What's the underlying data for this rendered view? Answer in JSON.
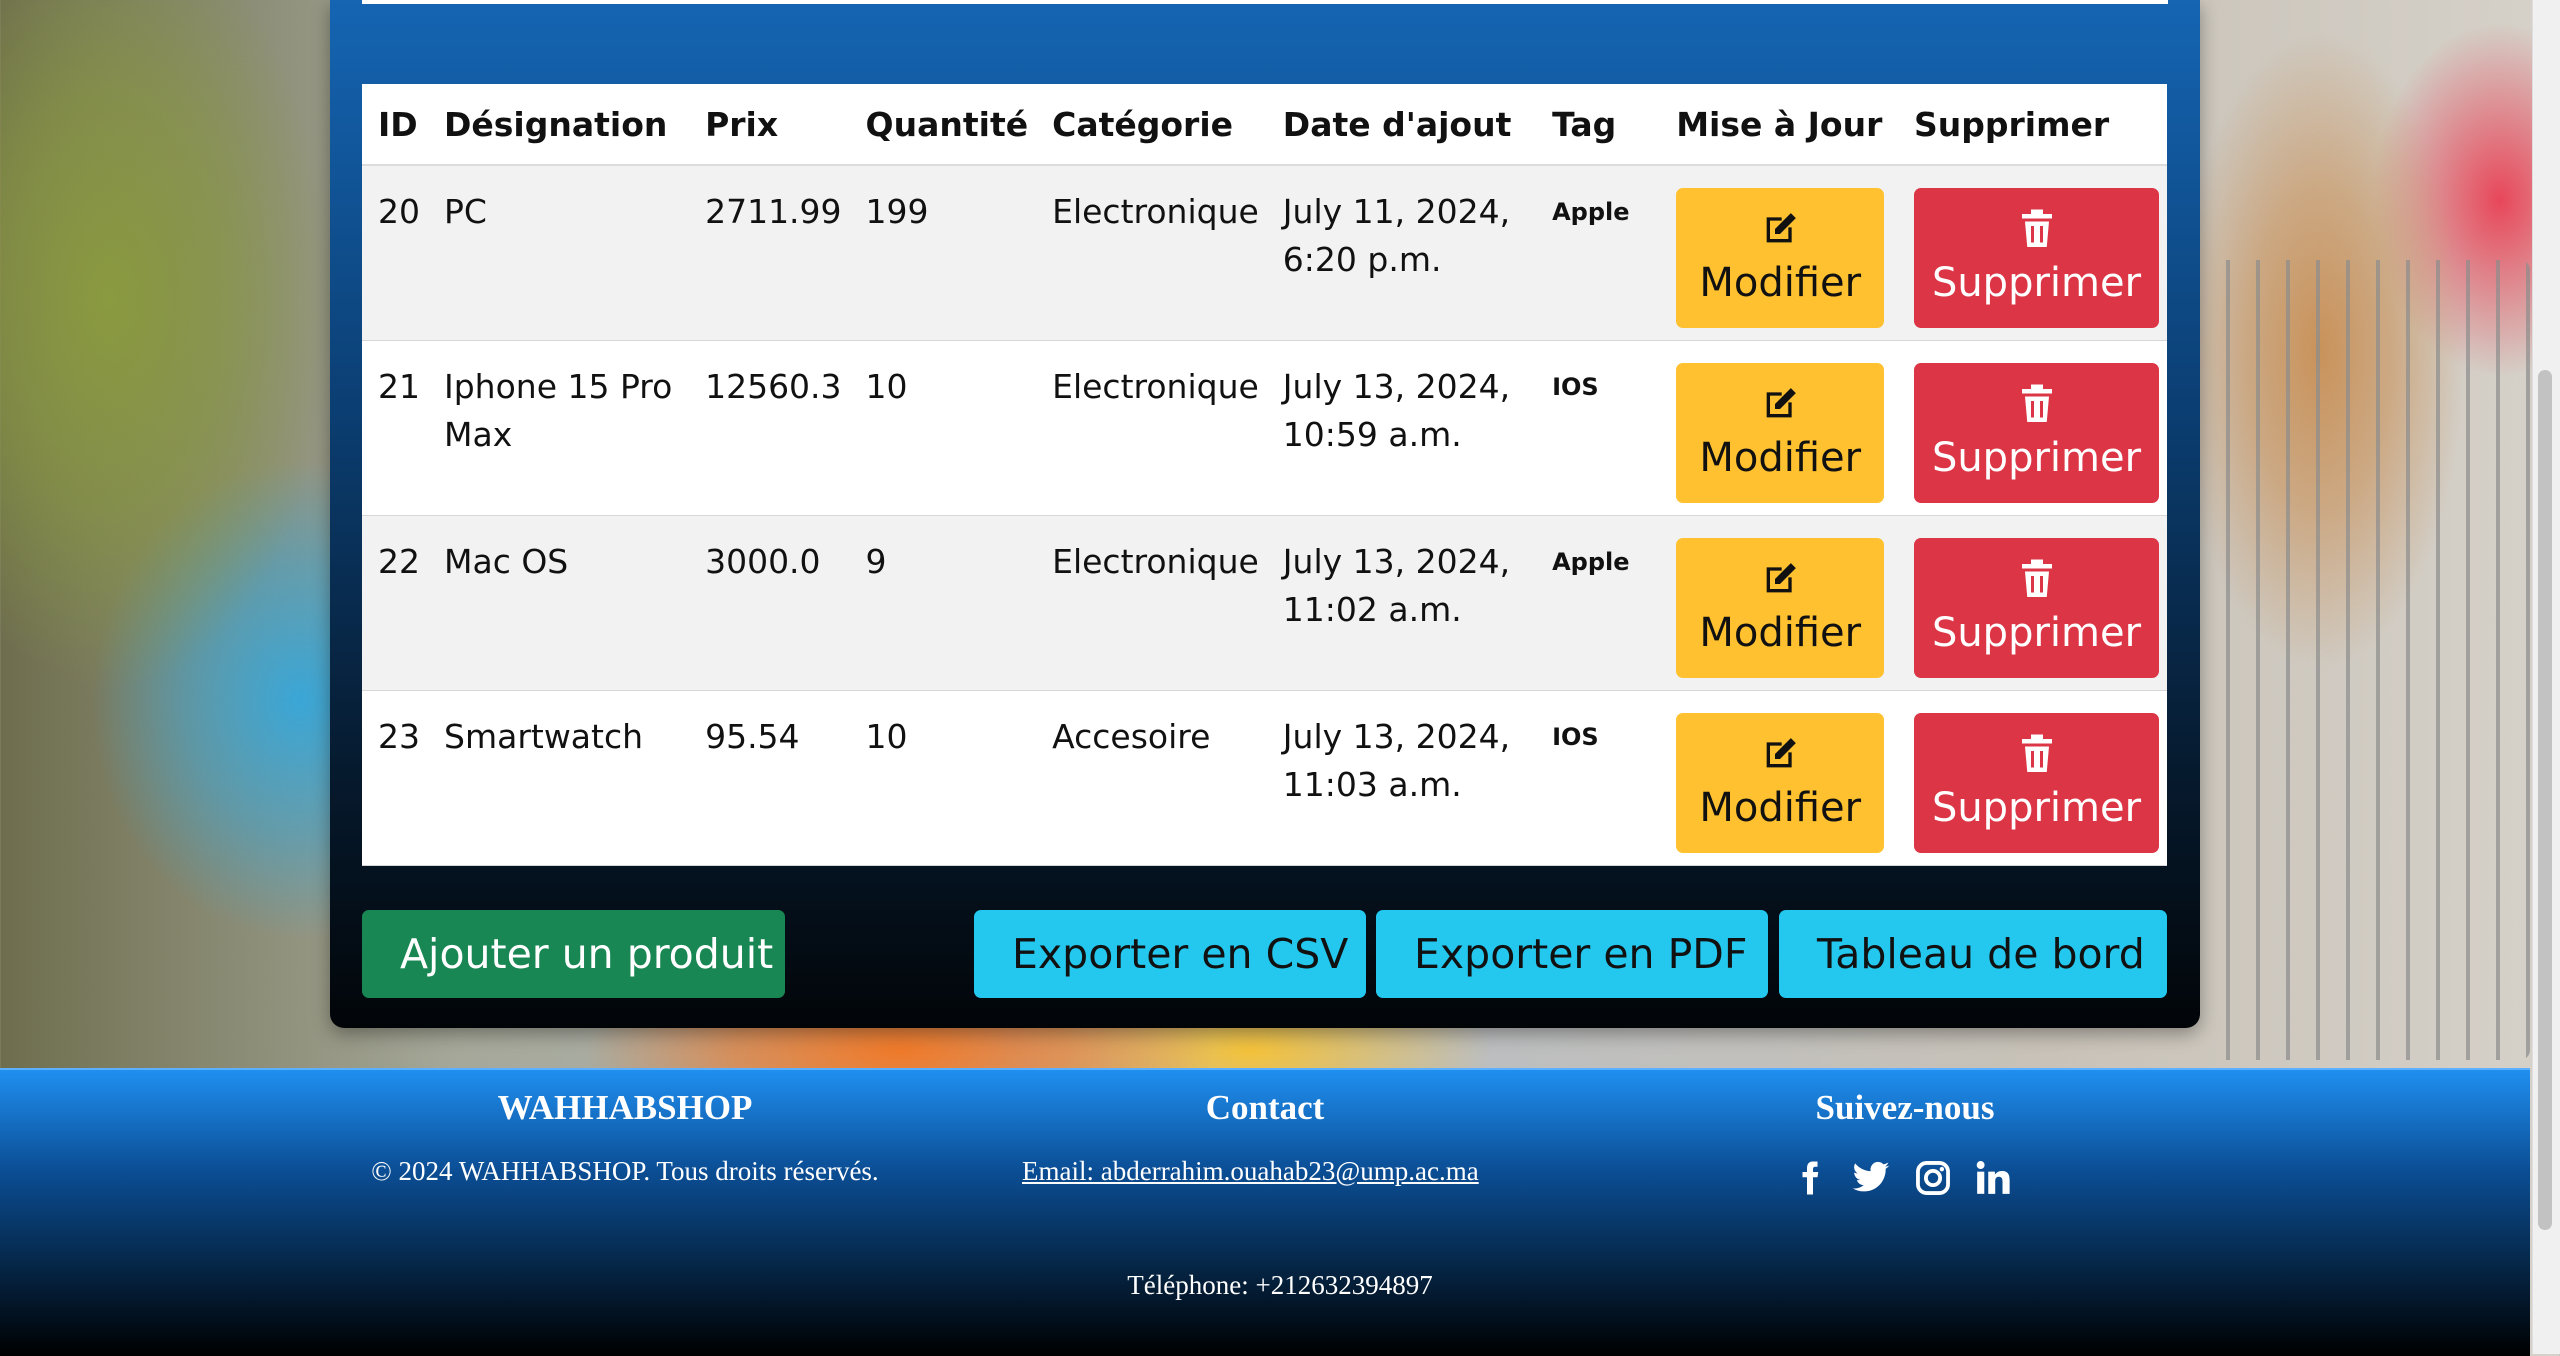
{
  "table": {
    "headers": [
      "ID",
      "Désignation",
      "Prix",
      "Quantité",
      "Catégorie",
      "Date d'ajout",
      "Tag",
      "Mise à Jour",
      "Supprimer"
    ],
    "rows": [
      {
        "id": "20",
        "designation": "PC",
        "prix": "2711.99",
        "quantite": "199",
        "categorie": "Electronique",
        "date_line1": "July 11, 2024,",
        "date_line2": "6:20 p.m.",
        "tag": "Apple"
      },
      {
        "id": "21",
        "designation": "Iphone 15 Pro Max",
        "prix": "12560.3",
        "quantite": "10",
        "categorie": "Electronique",
        "date_line1": "July 13, 2024,",
        "date_line2": "10:59 a.m.",
        "tag": "IOS"
      },
      {
        "id": "22",
        "designation": "Mac OS",
        "prix": "3000.0",
        "quantite": "9",
        "categorie": "Electronique",
        "date_line1": "July 13, 2024,",
        "date_line2": "11:02 a.m.",
        "tag": "Apple"
      },
      {
        "id": "23",
        "designation": "Smartwatch",
        "prix": "95.54",
        "quantite": "10",
        "categorie": "Accesoire",
        "date_line1": "July 13, 2024,",
        "date_line2": "11:03 a.m.",
        "tag": "IOS"
      }
    ],
    "modify_label": "Modifier",
    "delete_label": "Supprimer"
  },
  "actions": {
    "add_product": "Ajouter un produit",
    "export_csv": "Exporter en CSV",
    "export_pdf": "Exporter en PDF",
    "dashboard": "Tableau de bord"
  },
  "footer": {
    "brand_title": "WAHHABSHOP",
    "copyright": "© 2024 WAHHABSHOP. Tous droits réservés.",
    "contact_title": "Contact",
    "email": "Email: abderrahim.ouahab23@ump.ac.ma",
    "follow_title": "Suivez-nous",
    "social_icons": [
      "facebook-icon",
      "twitter-icon",
      "instagram-icon",
      "linkedin-icon"
    ],
    "phone": "Téléphone: +212632394897"
  },
  "colors": {
    "warning": "#ffc12f",
    "danger": "#dc3545",
    "success": "#198754",
    "info": "#24c8ef"
  }
}
